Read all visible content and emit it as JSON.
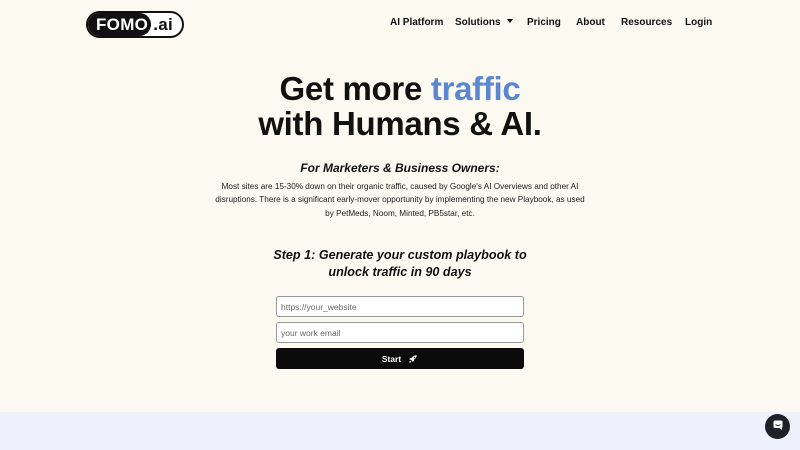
{
  "brand": {
    "logo_left": "FOMO",
    "logo_right": ".ai"
  },
  "nav": {
    "items": [
      {
        "label": "AI Platform"
      },
      {
        "label": "Solutions",
        "has_dropdown": true
      },
      {
        "label": "Pricing"
      },
      {
        "label": "About"
      },
      {
        "label": "Resources"
      },
      {
        "label": "Login"
      }
    ]
  },
  "hero": {
    "headline_part1": "Get more ",
    "headline_accent": "traffic",
    "headline_line2": "with Humans & AI.",
    "subhead": "For Marketers & Business Owners:",
    "body": "Most sites are 15-30% down on their organic traffic, caused by Google's AI Overviews and other AI disruptions. There is a significant early-mover opportunity by implementing the new Playbook, as used by PetMeds, Noom, Minted, PB5star, etc.",
    "step_line1": "Step 1: Generate your custom playbook to",
    "step_line2": "unlock traffic in 90 days"
  },
  "form": {
    "website": {
      "placeholder": "https://your_website",
      "value": ""
    },
    "email": {
      "placeholder": "your work email",
      "value": ""
    },
    "start_label": "Start",
    "start_icon": "rocket-icon"
  },
  "chat": {
    "icon": "chat-icon"
  },
  "colors": {
    "page_bg": "#fcfaf0",
    "accent": "#5b87d1",
    "button_bg": "#0b0b0b",
    "band_bg": "#eef1fa",
    "chat_bg": "#1f2126"
  }
}
